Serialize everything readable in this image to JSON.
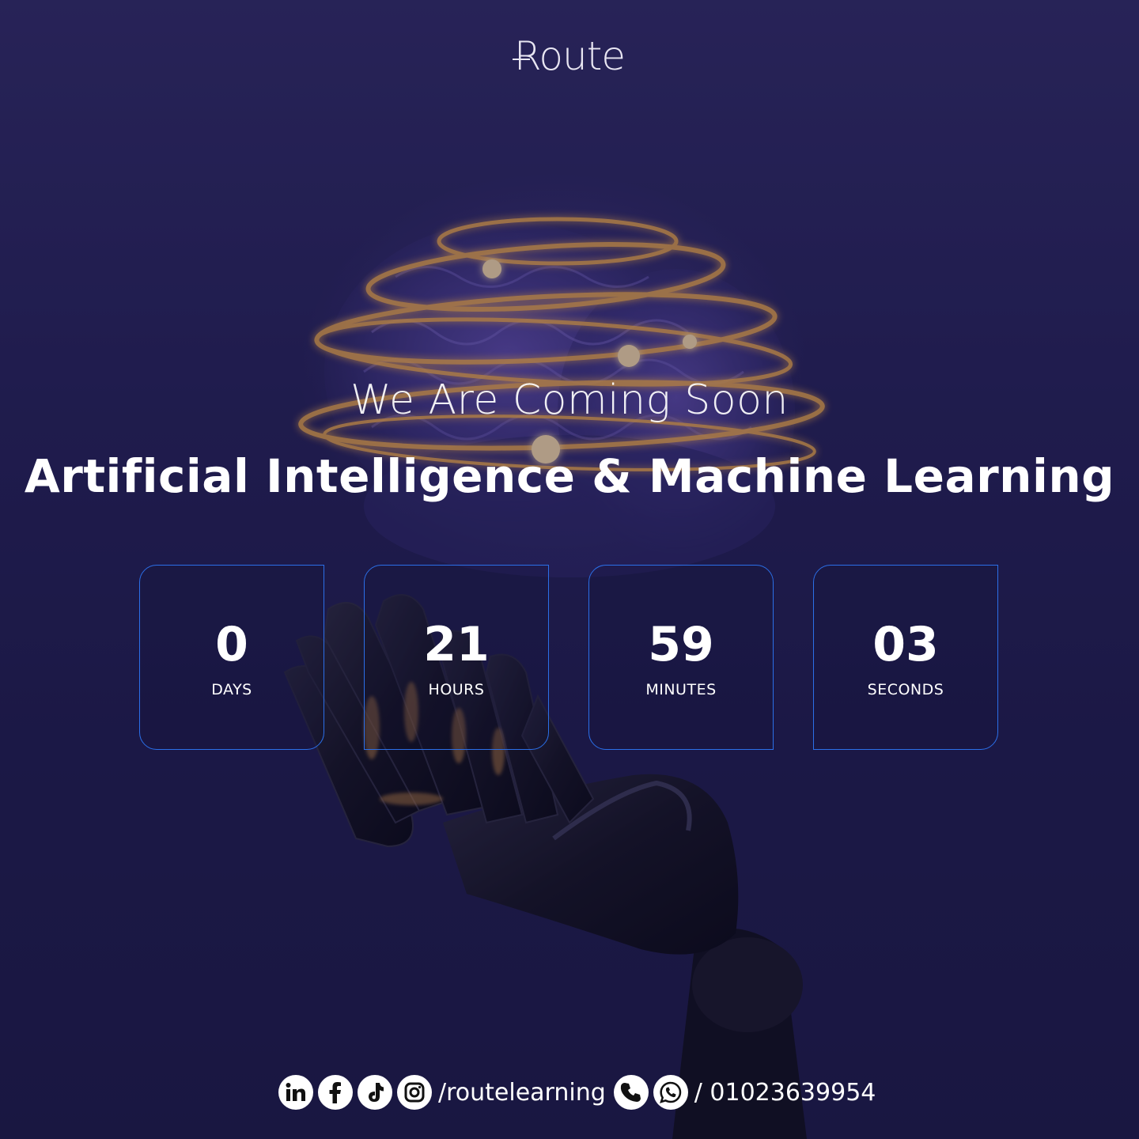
{
  "brand": {
    "logo_text": "Route"
  },
  "hero": {
    "subtitle": "We Are Coming Soon",
    "title": "Artificial Intelligence & Machine Learning"
  },
  "countdown": [
    {
      "value": "0",
      "label": "DAYS"
    },
    {
      "value": "21",
      "label": "HOURS"
    },
    {
      "value": "59",
      "label": "MINUTES"
    },
    {
      "value": "03",
      "label": "SECONDS"
    }
  ],
  "footer": {
    "social_icons": [
      "linkedin-icon",
      "facebook-icon",
      "tiktok-icon",
      "instagram-icon"
    ],
    "handle": "/routelearning",
    "contact_icons": [
      "phone-icon",
      "whatsapp-icon"
    ],
    "phone": "/ 01023639954"
  },
  "colors": {
    "background_top": "#2f2a62",
    "background_bottom": "#1a1740",
    "box_border": "#2b6fe8",
    "glow": "#ffb545",
    "text": "#ffffff"
  }
}
